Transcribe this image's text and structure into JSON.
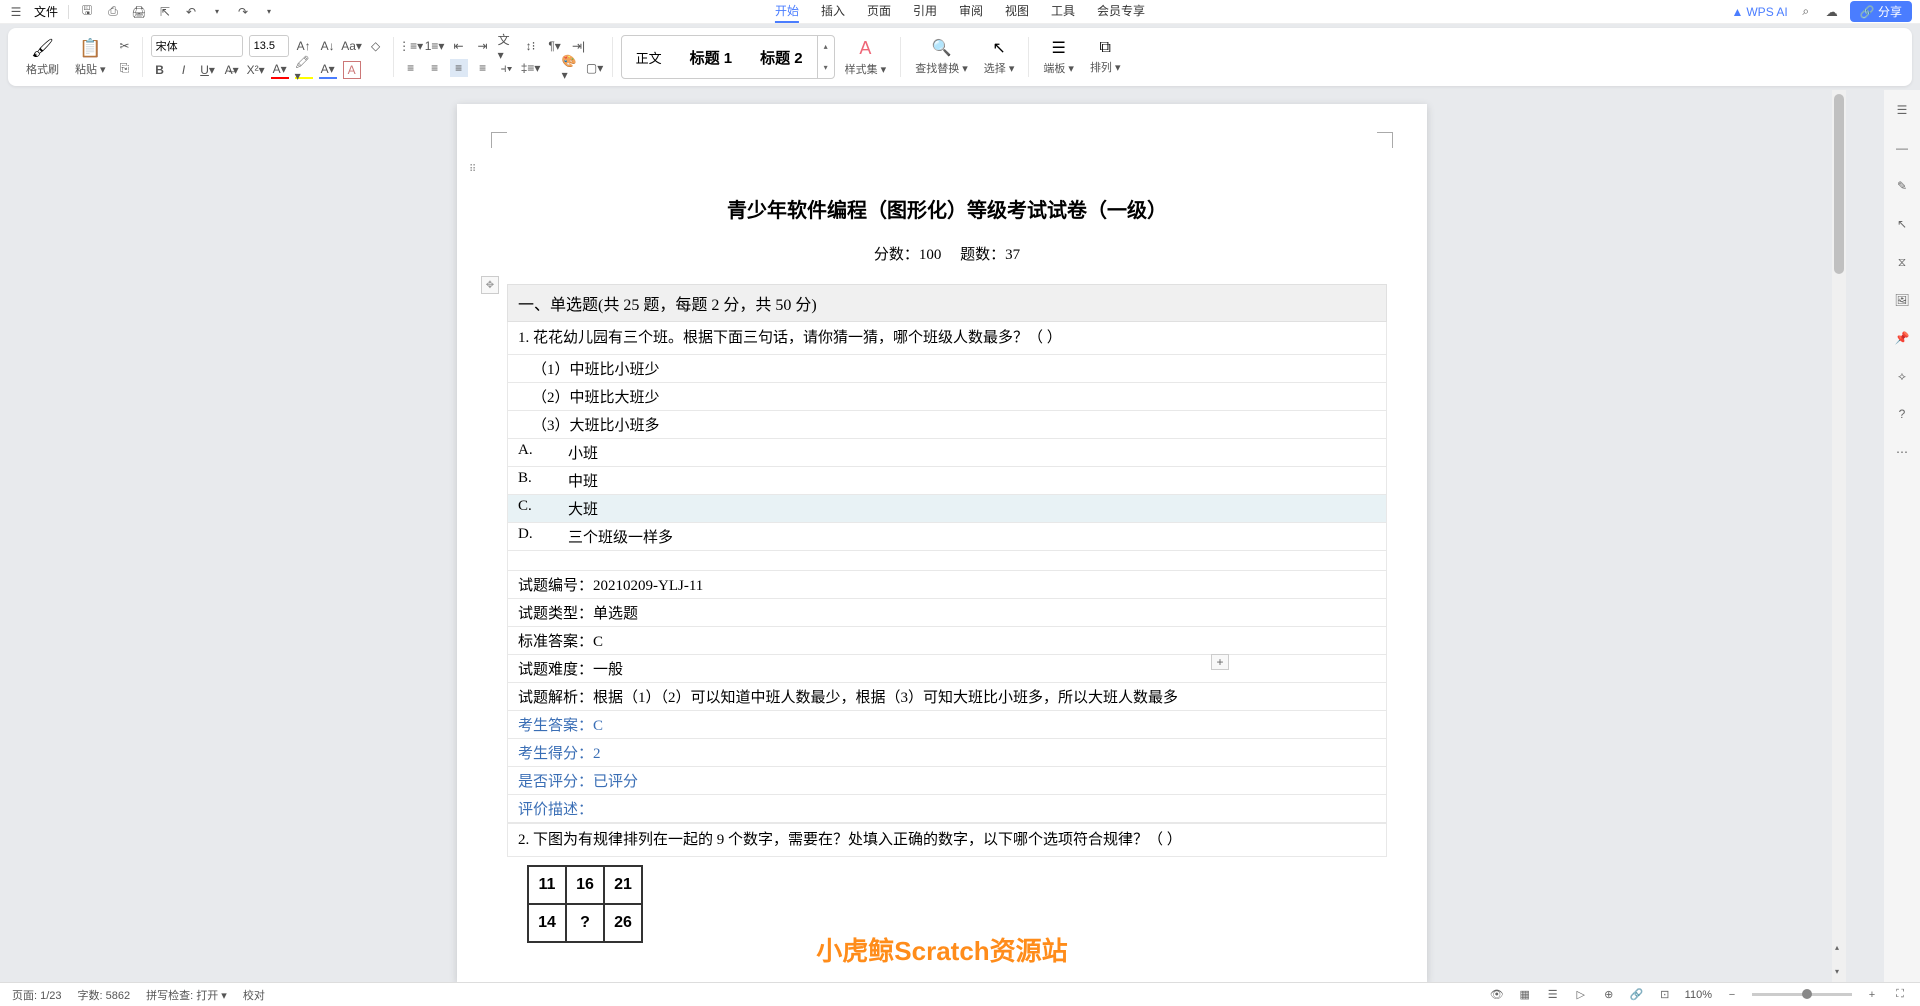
{
  "titlebar": {
    "file_label": "文件",
    "menus": [
      "开始",
      "插入",
      "页面",
      "引用",
      "审阅",
      "视图",
      "工具",
      "会员专享"
    ],
    "active_menu_index": 0,
    "wps_ai": "WPS AI",
    "share": "分享"
  },
  "ribbon": {
    "format_painter": "格式刷",
    "paste": "粘贴",
    "font_name": "宋体",
    "font_size": "13.5",
    "styles": {
      "body": "正文",
      "h1": "标题 1",
      "h2": "标题 2"
    },
    "style_set": "样式集",
    "find_replace": "查找替换",
    "select": "选择",
    "panels": "端板",
    "arrange": "排列"
  },
  "doc": {
    "title": "青少年软件编程（图形化）等级考试试卷（一级）",
    "meta_score": "分数：100",
    "meta_count": "题数：37",
    "section1": "一、单选题(共 25 题，每题 2 分，共 50 分)",
    "q1": {
      "num": "1.",
      "text": "花花幼儿园有三个班。根据下面三句话，请你猜一猜，哪个班级人数最多？（   ）",
      "lines": [
        "（1）中班比小班少",
        "（2）中班比大班少",
        "（3）大班比小班多"
      ],
      "opts": [
        {
          "l": "A.",
          "t": "小班"
        },
        {
          "l": "B.",
          "t": "中班"
        },
        {
          "l": "C.",
          "t": "大班"
        },
        {
          "l": "D.",
          "t": "三个班级一样多"
        }
      ],
      "info": [
        {
          "k": "试题编号：",
          "v": "20210209-YLJ-11"
        },
        {
          "k": "试题类型：",
          "v": "单选题"
        },
        {
          "k": "标准答案：",
          "v": "C"
        },
        {
          "k": "试题难度：",
          "v": "一般"
        },
        {
          "k": "试题解析：",
          "v": "根据（1）（2）可以知道中班人数最少，根据（3）可知大班比小班多，所以大班人数最多"
        }
      ],
      "blue": [
        {
          "k": "考生答案：",
          "v": "C"
        },
        {
          "k": "考生得分：",
          "v": "2"
        },
        {
          "k": "是否评分：",
          "v": "已评分"
        },
        {
          "k": "评价描述：",
          "v": ""
        }
      ]
    },
    "q2": {
      "num": "2.",
      "text": "下图为有规律排列在一起的 9 个数字，需要在？处填入正确的数字，以下哪个选项符合规律？（   ）",
      "table": [
        [
          "11",
          "16",
          "21"
        ],
        [
          "14",
          "?",
          "26"
        ]
      ]
    },
    "watermark": "小虎鲸Scratch资源站"
  },
  "statusbar": {
    "page": "页面: 1/23",
    "words": "字数: 5862",
    "spell": "拼写检查: 打开",
    "proof": "校对",
    "zoom": "110%"
  }
}
